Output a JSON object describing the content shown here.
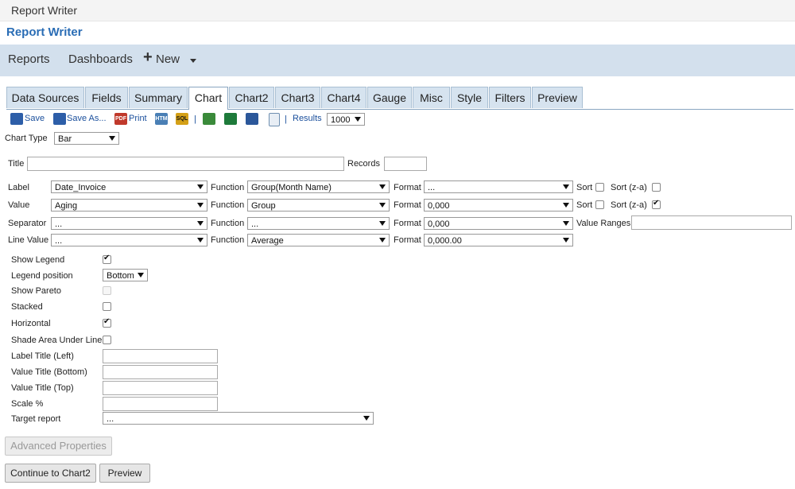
{
  "window": {
    "title": "Report Writer"
  },
  "app": {
    "title": "Report Writer"
  },
  "nav": {
    "reports": "Reports",
    "dashboards": "Dashboards",
    "plus": "+",
    "new": "New"
  },
  "tabs": [
    "Data Sources",
    "Fields",
    "Summary",
    "Chart",
    "Chart2",
    "Chart3",
    "Chart4",
    "Gauge",
    "Misc",
    "Style",
    "Filters",
    "Preview"
  ],
  "toolbar": {
    "save": "Save",
    "save_as": "Save As...",
    "print": "Print",
    "sep": "|",
    "results_label": "Results",
    "results_value": "1000"
  },
  "icons": {
    "pdf": "PDF",
    "html": "HTM",
    "sql": "SQL"
  },
  "chart_type": {
    "label": "Chart Type",
    "value": "Bar"
  },
  "title_row": {
    "title_label": "Title",
    "title_value": "",
    "records_label": "Records",
    "records_value": ""
  },
  "rows": {
    "label": {
      "name": "Label",
      "field": "Date_Invoice",
      "function_label": "Function",
      "function": "Group(Month Name)",
      "format_label": "Format",
      "format": "...",
      "sort_label": "Sort",
      "sort_za_label": "Sort (z-a)"
    },
    "value": {
      "name": "Value",
      "field": "Aging",
      "function_label": "Function",
      "function": "Group",
      "format_label": "Format",
      "format": "0,000",
      "sort_label": "Sort",
      "sort_za_label": "Sort (z-a)"
    },
    "separator": {
      "name": "Separator",
      "field": "...",
      "function_label": "Function",
      "function": "...",
      "format_label": "Format",
      "format": "0,000",
      "value_ranges_label": "Value Ranges",
      "value_ranges": ""
    },
    "line_value": {
      "name": "Line Value",
      "field": "...",
      "function_label": "Function",
      "function": "Average",
      "format_label": "Format",
      "format": "0,000.00"
    }
  },
  "options": {
    "show_legend": "Show Legend",
    "legend_position": "Legend position",
    "legend_position_value": "Bottom",
    "show_pareto": "Show Pareto",
    "stacked": "Stacked",
    "horizontal": "Horizontal",
    "shade_area": "Shade Area Under Line",
    "label_title_left": "Label Title (Left)",
    "value_title_bottom": "Value Title (Bottom)",
    "value_title_top": "Value Title (Top)",
    "scale": "Scale %",
    "target_report": "Target report",
    "target_report_value": "..."
  },
  "buttons": {
    "advanced": "Advanced Properties",
    "continue": "Continue to Chart2",
    "preview": "Preview"
  },
  "colors": {
    "nav_bg": "#d3e0ed",
    "tab_bg": "#d6e3ef",
    "title_blue": "#2a6db5"
  }
}
